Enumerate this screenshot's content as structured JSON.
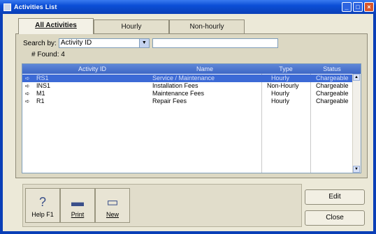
{
  "window": {
    "title": "Activities List",
    "controls": [
      "minimize",
      "maximize",
      "close"
    ]
  },
  "tabs": [
    {
      "label": "All Activities",
      "active": true
    },
    {
      "label": "Hourly",
      "active": false
    },
    {
      "label": "Non-hourly",
      "active": false
    }
  ],
  "search": {
    "label": "Search by:",
    "field_value": "Activity ID",
    "query_value": "",
    "found_text": "# Found: 4"
  },
  "grid": {
    "columns": [
      "Activity ID",
      "Name",
      "Type",
      "Status"
    ],
    "rows": [
      {
        "id": "RS1",
        "name": "Service / Maintenance",
        "type": "Hourly",
        "status": "Chargeable",
        "selected": true
      },
      {
        "id": "INS1",
        "name": "Installation Fees",
        "type": "Non-Hourly",
        "status": "Chargeable",
        "selected": false
      },
      {
        "id": "M1",
        "name": "Maintenance Fees",
        "type": "Hourly",
        "status": "Chargeable",
        "selected": false
      },
      {
        "id": "R1",
        "name": "Repair Fees",
        "type": "Hourly",
        "status": "Chargeable",
        "selected": false
      }
    ]
  },
  "toolbar": {
    "help_label": "Help F1",
    "print_label": "Print",
    "new_label": "New"
  },
  "actions": {
    "edit_label": "Edit",
    "close_label": "Close"
  },
  "colors": {
    "titlebar": "#0a3fb7",
    "selection": "#3c6ad6",
    "header": "#4a73cf",
    "face": "#ece9d8"
  }
}
